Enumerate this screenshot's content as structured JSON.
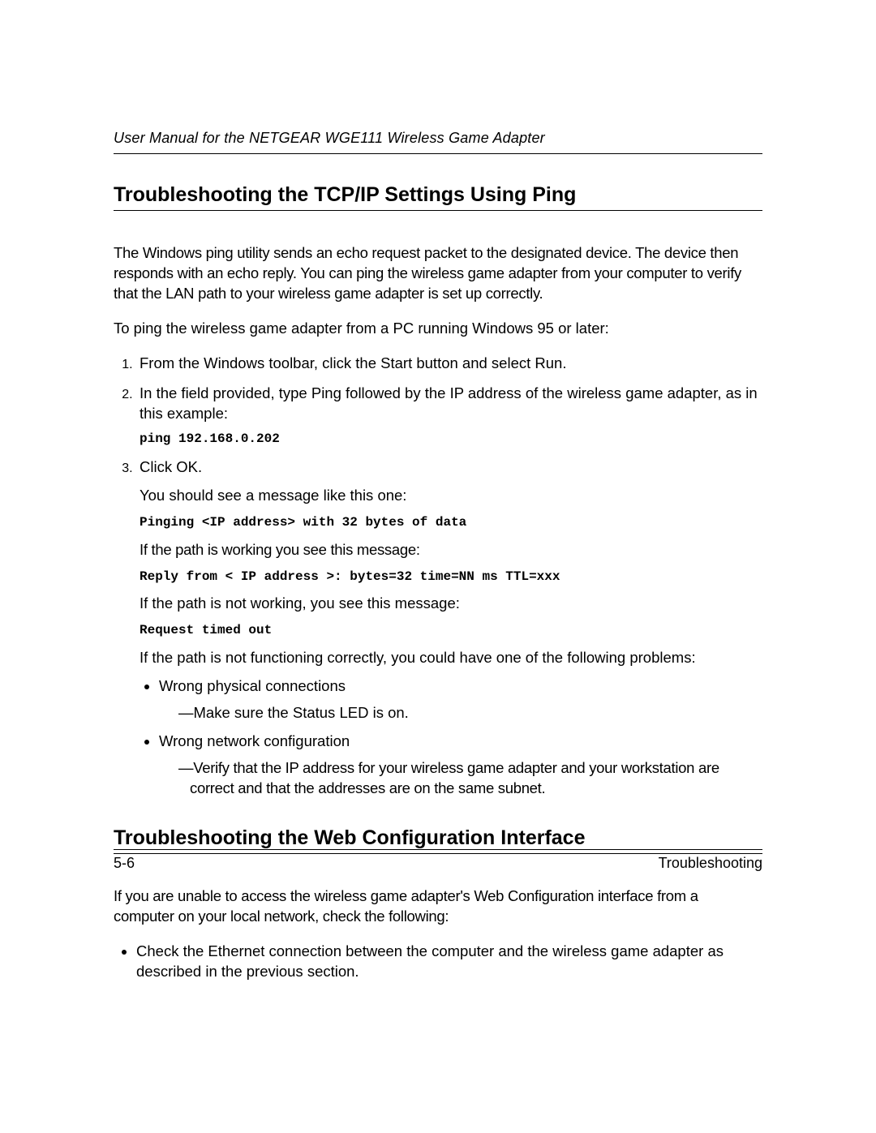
{
  "header": {
    "running_title": "User Manual for the NETGEAR WGE111 Wireless Game Adapter"
  },
  "section1": {
    "title": "Troubleshooting the TCP/IP Settings Using Ping",
    "para1": "The Windows ping utility sends an echo request packet to the designated device. The device then responds with an echo reply. You can ping the wireless game adapter from your computer to verify that the LAN path to your wireless game adapter is set up correctly.",
    "para2": "To ping the wireless game adapter from a PC running Windows 95 or later:",
    "step1": "From the Windows toolbar, click the Start button and select Run.",
    "step2": "In the field provided, type Ping followed by the IP address of the wireless game adapter, as in this example:",
    "code1": "ping 192.168.0.202",
    "step3": "Click OK.",
    "step3_p1": "You should see a message like this one:",
    "code2": "Pinging <IP address> with 32 bytes of data",
    "step3_p2": "If the path is working you see this message:",
    "code3": "Reply from < IP address >: bytes=32 time=NN ms TTL=xxx",
    "step3_p3": "If the path is not working, you see this message:",
    "code4": "Request timed out",
    "step3_p4": "If the path is not functioning correctly, you could have one of the following problems:",
    "bullet1": "Wrong physical connections",
    "bullet1_dash1": "Make sure the Status LED is on.",
    "bullet2": "Wrong network configuration",
    "bullet2_dash1": "Verify that the IP address for your wireless game adapter and your workstation are correct and that the addresses are on the same subnet."
  },
  "section2": {
    "title": "Troubleshooting the Web Configuration Interface",
    "para1": "If you are unable to access the wireless game adapter's Web Configuration interface from a computer on your local network, check the following:",
    "bullet1": "Check the Ethernet connection between the computer and the wireless game adapter as described in the previous section."
  },
  "footer": {
    "page": "5-6",
    "label": "Troubleshooting"
  }
}
